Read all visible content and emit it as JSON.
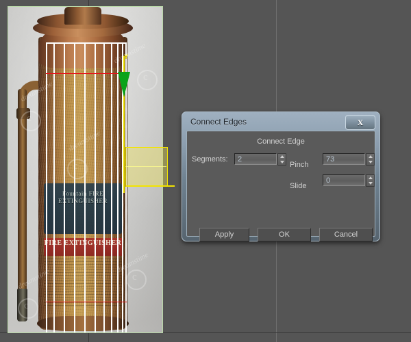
{
  "app": {
    "type": "3d-modeling-viewport",
    "background_color": "#555555",
    "grid_line_color": "#6f6f6f"
  },
  "viewport": {
    "name": "perspective-viewport",
    "reference_plane": {
      "name": "reference-image-plane",
      "outline_color": "#b9d8a8",
      "subject": "vintage copper fire extinguisher",
      "watermark_text": "dreamstime",
      "label_crest_text": "Fountain\nFIRE\nEXTINGUISHER",
      "label_band_text": "FIRE\nEXTINGUISHER"
    },
    "mesh": {
      "name": "editable-poly-cage",
      "wire_color": "#ffffff",
      "selected_edge_color": "#e8131a",
      "selected_edges": 2,
      "vertical_segments": 11
    },
    "gizmo": {
      "name": "move-transform-gizmo",
      "axis_label": "Y",
      "y_axis_color": "#f2e400",
      "y_arrow_color": "#0aa31a",
      "plane_handle_color": "#ebe15a"
    }
  },
  "dialog": {
    "name": "connect-edges-dialog",
    "title": "Connect Edges",
    "close_label": "X",
    "group": {
      "title": "Connect Edge",
      "fields": [
        {
          "label": "Segments:",
          "value": "2",
          "name": "segments"
        },
        {
          "label": "Pinch",
          "value": "73",
          "name": "pinch"
        },
        {
          "label": "Slide",
          "value": "0",
          "name": "slide"
        }
      ]
    },
    "buttons": [
      {
        "label": "Apply",
        "name": "apply"
      },
      {
        "label": "OK",
        "name": "ok"
      },
      {
        "label": "Cancel",
        "name": "cancel"
      }
    ]
  }
}
